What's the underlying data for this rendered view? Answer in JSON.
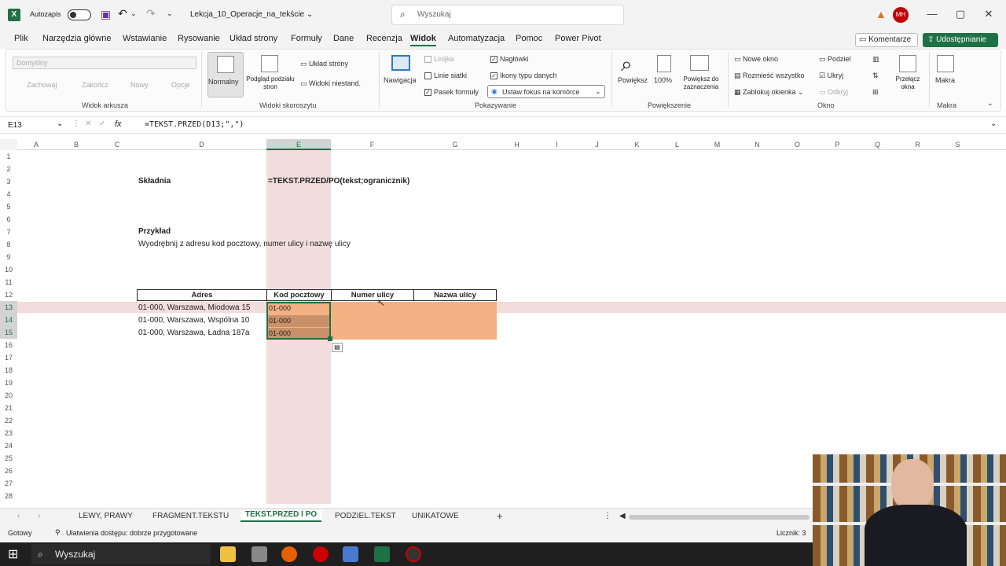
{
  "titlebar": {
    "autosave_label": "Autozapis",
    "file_name": "Lekcja_10_Operacje_na_tekście ⌄",
    "search_placeholder": "Wyszukaj",
    "user_initials": "MH"
  },
  "menu": {
    "tabs": [
      "Plik",
      "Narzędzia główne",
      "Wstawianie",
      "Rysowanie",
      "Układ strony",
      "Formuły",
      "Dane",
      "Recenzja",
      "Widok",
      "Automatyzacja",
      "Pomoc",
      "Power Pivot"
    ],
    "active": "Widok",
    "comments_label": "Komentarze",
    "share_label": "Udostępnianie"
  },
  "ribbon": {
    "sheet_view": {
      "dropdown": "Domyślny",
      "keep": "Zachowaj",
      "exit": "Zakończ",
      "new": "Nowy",
      "options": "Opcje",
      "group": "Widok arkusza"
    },
    "workbook_views": {
      "normal": "Normalny",
      "page_break": "Podgląd podziału stron",
      "page_layout": "Układ strony",
      "custom": "Widoki niestand.",
      "group": "Widoki skoroszytu"
    },
    "show": {
      "navigation": "Nawigacja",
      "ruler": "Linijka",
      "gridlines": "Linie siatki",
      "formula_bar": "Pasek formuły",
      "headings": "Nagłówki",
      "data_type_icons": "Ikony typu danych",
      "focus_cell": "Ustaw fokus na komórce",
      "group": "Pokazywanie"
    },
    "zoom": {
      "zoom": "Powiększ",
      "percent": "100%",
      "zoom_selection": "Powiększ do zaznaczenia",
      "group": "Powiększenie"
    },
    "window": {
      "new_window": "Nowe okno",
      "arrange_all": "Rozmieść wszystko",
      "freeze": "Zablokuj okienka",
      "split": "Podziel",
      "hide": "Ukryj",
      "unhide": "Odkryj",
      "switch": "Przełącz okna",
      "group": "Okno"
    },
    "macros": {
      "macros": "Makra",
      "group": "Makra"
    }
  },
  "formula_bar": {
    "name_box": "E13",
    "fx": "fx",
    "formula": "=TEKST.PRZED(D13;\",\")"
  },
  "columns": [
    "A",
    "B",
    "C",
    "D",
    "E",
    "F",
    "G",
    "H",
    "I",
    "J",
    "K",
    "L",
    "M",
    "N",
    "O",
    "P",
    "Q",
    "R",
    "S"
  ],
  "rows": [
    "1",
    "2",
    "3",
    "4",
    "5",
    "6",
    "7",
    "8",
    "9",
    "10",
    "11",
    "12",
    "13",
    "14",
    "15",
    "16",
    "17",
    "18",
    "19",
    "20",
    "21",
    "22",
    "23",
    "24",
    "25",
    "26",
    "27",
    "28"
  ],
  "cells": {
    "skladnia": "Składnia",
    "syntax": "=TEKST.PRZED/PO(tekst;ogranicznik)",
    "przyklad": "Przykład",
    "task": "Wyodrębnij z adresu kod pocztowy, numer ulicy i nazwę ulicy"
  },
  "table": {
    "headers": [
      "Adres",
      "Kod pocztowy",
      "Numer ulicy",
      "Nazwa ulicy"
    ],
    "rows": [
      {
        "adres": "01-000, Warszawa, Miodowa 15",
        "kod": "01-000"
      },
      {
        "adres": "01-000, Warszawa, Wspólna 10",
        "kod": "01-000"
      },
      {
        "adres": "01-000, Warszawa, Ładna 187a",
        "kod": "01-000"
      }
    ]
  },
  "sheets": {
    "tabs": [
      "LEWY, PRAWY",
      "FRAGMENT.TEKSTU",
      "TEKST.PRZED I PO",
      "PODZIEL.TEKST",
      "UNIKATOWE"
    ],
    "active_index": 2,
    "add": "+"
  },
  "status": {
    "ready": "Gotowy",
    "accessibility": "Ułatwienia dostępu: dobrze przygotowane",
    "count": "Licznik: 3"
  },
  "taskbar": {
    "search": "Wyszukaj"
  },
  "colors": {
    "accent": "#1e7145",
    "highlight": "#f3dcdc",
    "orange": "#f4b183"
  }
}
